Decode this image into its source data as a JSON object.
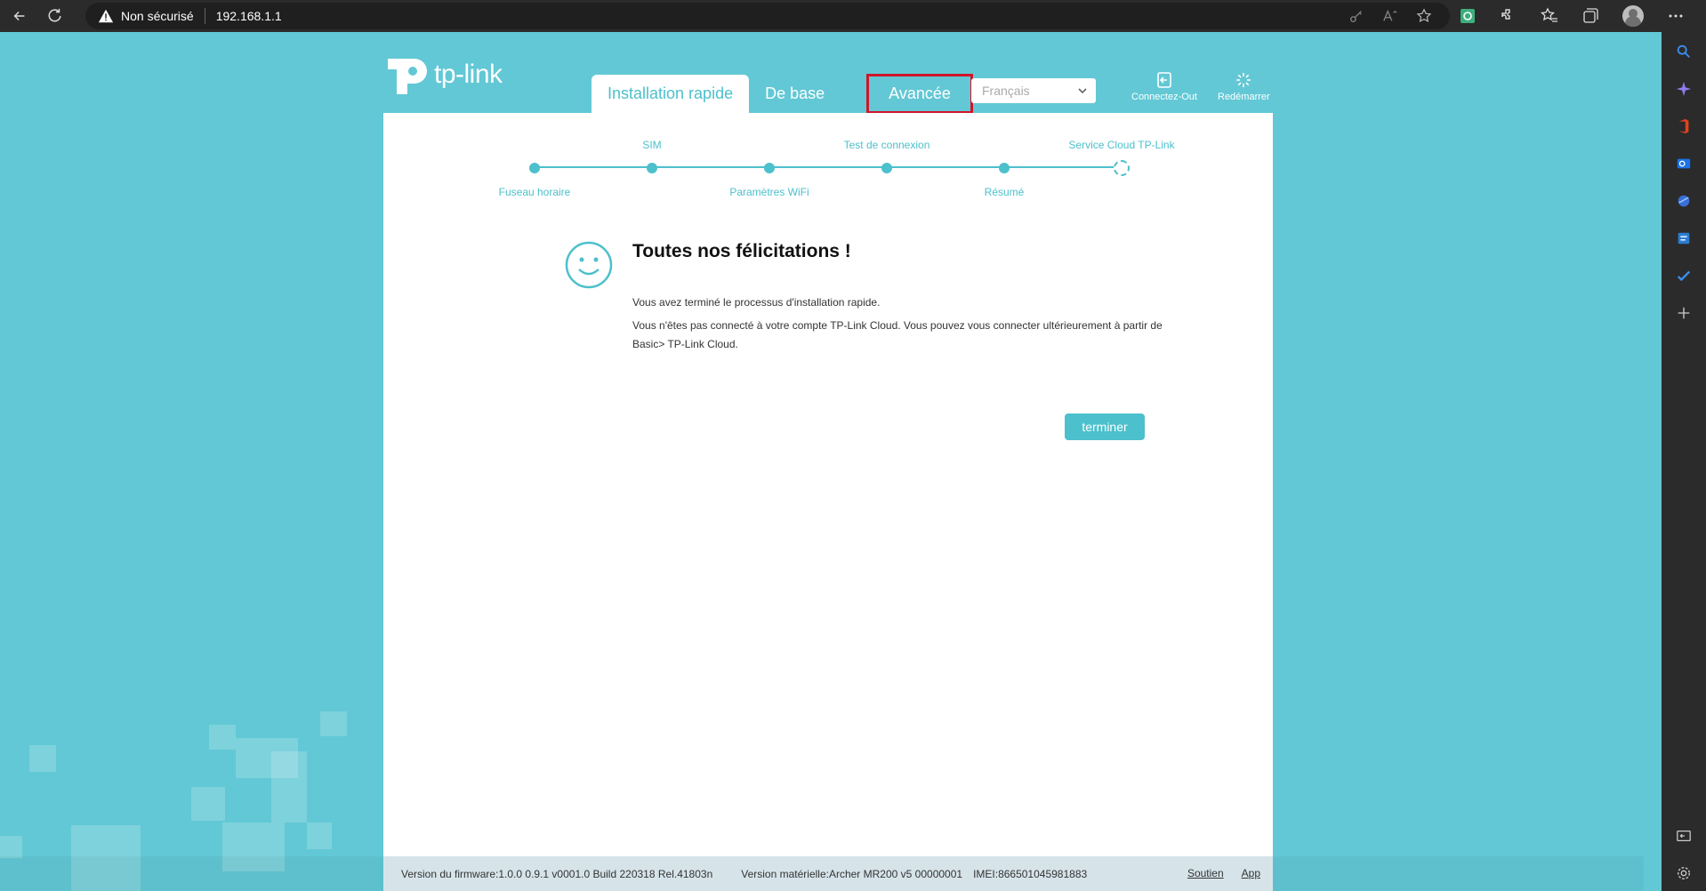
{
  "browser": {
    "security_label": "Non sécurisé",
    "url": "192.168.1.1"
  },
  "header": {
    "logo_text": "tp-link",
    "tabs": [
      {
        "label": "Installation rapide"
      },
      {
        "label": "De base"
      },
      {
        "label": "Avancée"
      }
    ],
    "language": "Français",
    "logout_label": "Connectez-Out",
    "reboot_label": "Redémarrer"
  },
  "wizard": {
    "steps_top": [
      "SIM",
      "Test de connexion",
      "Service Cloud TP-Link"
    ],
    "steps_bottom": [
      "Fuseau horaire",
      "Paramètres WiFi",
      "Résumé"
    ]
  },
  "content": {
    "title": "Toutes nos félicitations !",
    "line1": "Vous avez terminé le processus d'installation rapide.",
    "line2a": "Vous n'êtes pas connecté à votre compte TP-Link Cloud. Vous pouvez vous connecter ultérieurement à partir de",
    "line2b": "Basic> TP-Link Cloud.",
    "finish_label": "terminer"
  },
  "footer": {
    "firmware": "Version du firmware:1.0.0 0.9.1 v0001.0 Build 220318 Rel.41803n",
    "hardware": "Version matérielle:Archer MR200 v5 00000001",
    "imei": "IMEI:866501045981883",
    "support": "Soutien",
    "app": "App"
  },
  "colors": {
    "accent": "#4cc0cc",
    "background": "#62c8d5",
    "highlight": "#d0152a"
  }
}
